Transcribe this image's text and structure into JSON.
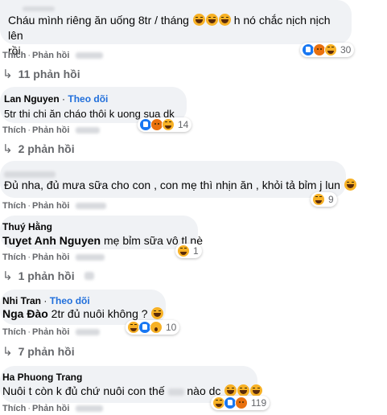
{
  "comments": [
    {
      "text_before": "Cháu mình riêng ăn uống 8tr / tháng",
      "text_after": " h nó chắc nịch nịch lên",
      "text_line2": "rồi",
      "like_label": "Thích",
      "reply_label": "Phản hồi",
      "reaction_count": "30",
      "reactions": [
        "like-icon",
        "angry-icon",
        "haha-icon"
      ]
    },
    {
      "author": "Lan Nguyen",
      "follow_label": "Theo dõi",
      "text": "5tr thi chi ăn cháo thôi k uong sua dk",
      "like_label": "Thích",
      "reply_label": "Phản hồi",
      "reaction_count": "14",
      "reactions": [
        "like-icon",
        "angry-icon",
        "haha-icon"
      ]
    },
    {
      "text": "Đủ nha, đủ mưa sữa cho con , con mẹ thì nhịn ăn , khỏi tả bỉm j lun",
      "like_label": "Thích",
      "reply_label": "Phản hồi",
      "reaction_count": "9",
      "reactions": [
        "haha-icon"
      ]
    },
    {
      "author": "Thuý Hằng",
      "mention": "Tuyet Anh Nguyen",
      "text": " mẹ bỉm sữa vô tl nè",
      "like_label": "Thích",
      "reply_label": "Phản hồi",
      "reaction_count": "1",
      "reactions": [
        "haha-icon"
      ]
    },
    {
      "author": "Nhi Tran",
      "follow_label": "Theo dõi",
      "mention": "Nga Đào",
      "text": " 2tr đủ nuôi không ?",
      "like_label": "Thích",
      "reply_label": "Phản hồi",
      "reaction_count": "10",
      "reactions": [
        "haha-icon",
        "like-icon",
        "wow-icon"
      ]
    },
    {
      "author": "Ha Phuong Trang",
      "text_before": "Nuôi t còn k đủ chứ nuôi con thế",
      "text_after": "nào dc",
      "like_label": "Thích",
      "reply_label": "Phản hồi",
      "reaction_count": "119",
      "reactions": [
        "haha-icon",
        "like-icon",
        "angry-icon"
      ]
    }
  ],
  "reply_threads": [
    {
      "label": "11 phản hồi"
    },
    {
      "label": "2 phản hồi"
    },
    {
      "label": "1 phản hồi"
    },
    {
      "label": "7 phản hồi"
    }
  ]
}
